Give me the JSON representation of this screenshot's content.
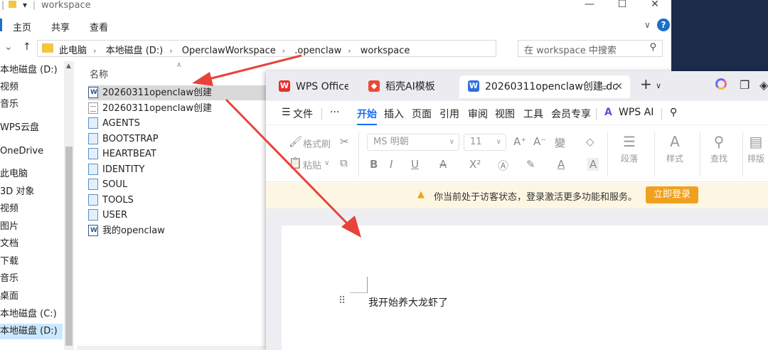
{
  "explorer": {
    "title": "workspace",
    "ribbon_tabs": [
      "主页",
      "共享",
      "查看"
    ],
    "breadcrumbs": [
      "此电脑",
      "本地磁盘 (D:)",
      "OperclawWorkspace",
      ".openclaw",
      "workspace"
    ],
    "search_placeholder": "在 workspace 中搜索",
    "column_name": "名称",
    "nav_items": [
      "本地磁盘 (D:)",
      "视频",
      "音乐",
      "WPS云盘",
      "OneDrive",
      "此电脑",
      "3D 对象",
      "视频",
      "图片",
      "文档",
      "下载",
      "音乐",
      "桌面",
      "本地磁盘 (C:)",
      "本地磁盘 (D:)"
    ],
    "files": [
      {
        "name": "20260311openclaw创建",
        "type": "word",
        "selected": true
      },
      {
        "name": "20260311openclaw创建",
        "type": "txt"
      },
      {
        "name": "AGENTS",
        "type": "md"
      },
      {
        "name": "BOOTSTRAP",
        "type": "md"
      },
      {
        "name": "HEARTBEAT",
        "type": "md"
      },
      {
        "name": "IDENTITY",
        "type": "md"
      },
      {
        "name": "SOUL",
        "type": "md"
      },
      {
        "name": "TOOLS",
        "type": "md"
      },
      {
        "name": "USER",
        "type": "md"
      },
      {
        "name": "我的openclaw",
        "type": "word"
      }
    ]
  },
  "wps": {
    "tabs": {
      "office": "WPS Office",
      "template": "稻壳AI模板",
      "doc": "20260311openclaw创建.dc"
    },
    "menu": {
      "file": "文件",
      "more": "···",
      "items": [
        "开始",
        "插入",
        "页面",
        "引用",
        "审阅",
        "视图",
        "工具",
        "会员专享"
      ],
      "ai": "WPS AI"
    },
    "toolbar": {
      "format_painter": "格式刷",
      "paste": "粘贴",
      "font": "MS 明朝",
      "size": "11",
      "paragraph": "段落",
      "style": "样式",
      "find": "查找",
      "arrange": "排版"
    },
    "notice": {
      "message": "你当前处于访客状态，登录激活更多功能和服务。",
      "login": "立即登录"
    },
    "document": {
      "text": "我开始养大龙虾了"
    }
  },
  "colors": {
    "accent": "#1b6ff0",
    "arrow": "#e8423a",
    "login": "#f0a020",
    "selection": "#cce8ff"
  }
}
